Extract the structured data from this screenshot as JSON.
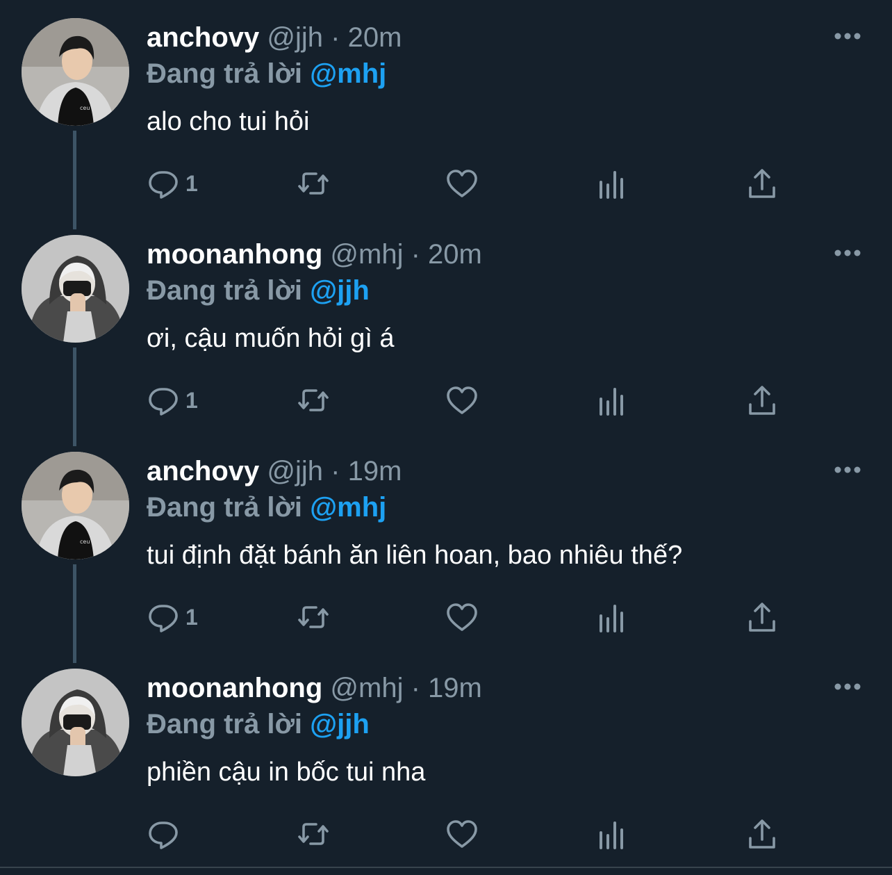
{
  "colors": {
    "background": "#15202b",
    "name": "#ffffff",
    "muted": "#8899a6",
    "accent": "#1da1f2",
    "thread_line": "#3d5466"
  },
  "tweets": [
    {
      "name": "anchovy",
      "handle": "@jjh",
      "dot": "·",
      "time": "20m",
      "reply_prefix": "Đang trả lời",
      "reply_to": "@mhj",
      "text": "alo cho tui hỏi",
      "reply_count": "1",
      "avatar": "anchovy-avatar",
      "more_icon": "more-icon"
    },
    {
      "name": "moonanhong",
      "handle": "@mhj",
      "dot": "·",
      "time": "20m",
      "reply_prefix": "Đang trả lời",
      "reply_to": "@jjh",
      "text": "ơi, cậu muốn hỏi gì á",
      "reply_count": "1",
      "avatar": "moonanhong-avatar",
      "more_icon": "more-icon"
    },
    {
      "name": "anchovy",
      "handle": "@jjh",
      "dot": "·",
      "time": "19m",
      "reply_prefix": "Đang trả lời",
      "reply_to": "@mhj",
      "text": "tui định đặt bánh ăn liên hoan, bao nhiêu thế?",
      "reply_count": "1",
      "avatar": "anchovy-avatar",
      "more_icon": "more-icon"
    },
    {
      "name": "moonanhong",
      "handle": "@mhj",
      "dot": "·",
      "time": "19m",
      "reply_prefix": "Đang trả lời",
      "reply_to": "@jjh",
      "text": "phiền cậu in bốc tui nha",
      "reply_count": "",
      "avatar": "moonanhong-avatar",
      "more_icon": "more-icon"
    }
  ],
  "action_icons": [
    "reply-icon",
    "retweet-icon",
    "like-icon",
    "analytics-icon",
    "share-icon"
  ]
}
